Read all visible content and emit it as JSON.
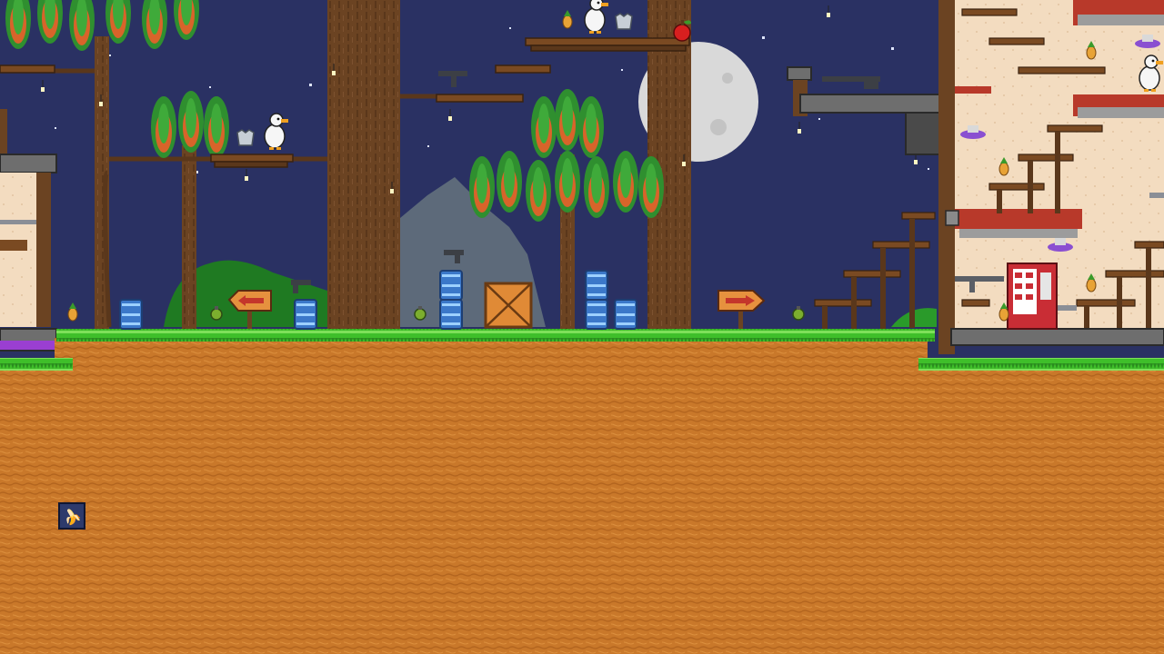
{
  "game": {
    "scene": "night-jungle-level",
    "palette": {
      "sky": "#2a3163",
      "ground": "#c9782a",
      "grass": "#3fbf2a",
      "trunk": "#6b4322",
      "leaf": "#2f8f2f",
      "leaf_under": "#d8642a",
      "moon": "#d9d9d9",
      "wall": "#f3dcc0",
      "trim_red": "#b8392a",
      "stone": "#5f5f5f",
      "barrel": "#3b78c9",
      "crate": "#e08a36",
      "sign": "#e6913e",
      "arrow": "#c4362b",
      "vending": "#c92d35"
    },
    "signs": [
      {
        "direction": "left"
      },
      {
        "direction": "right"
      }
    ],
    "characters": [
      {
        "type": "duck",
        "color": "white"
      },
      {
        "type": "duck",
        "color": "white"
      },
      {
        "type": "duck",
        "color": "white"
      }
    ],
    "items": [
      "pistol-icon",
      "smg-icon",
      "shotgun-icon",
      "rifle-icon",
      "chestplate-icon",
      "grenade-icon",
      "pineapple-icon",
      "apple-icon",
      "crate-icon",
      "barrel-icon",
      "vending-machine-icon",
      "hat-icon"
    ],
    "hud": {
      "inventory_icon": "banana-icon",
      "inventory_glyph": "🍌"
    }
  }
}
